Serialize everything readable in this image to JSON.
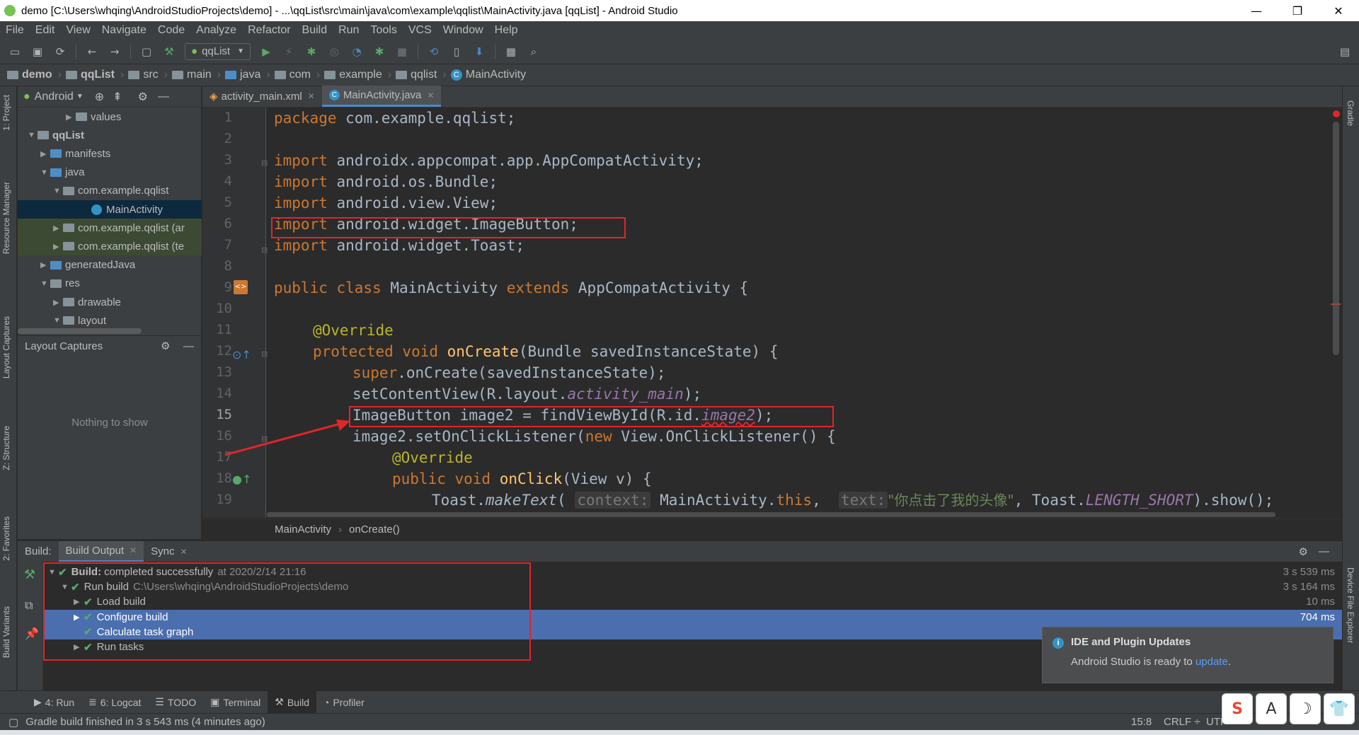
{
  "window": {
    "title": "demo [C:\\Users\\whqing\\AndroidStudioProjects\\demo] - ...\\qqList\\src\\main\\java\\com\\example\\qqlist\\MainActivity.java [qqList] - Android Studio",
    "minimize": "—",
    "maximize": "❐",
    "close": "✕"
  },
  "menu": [
    "File",
    "Edit",
    "View",
    "Navigate",
    "Code",
    "Analyze",
    "Refactor",
    "Build",
    "Run",
    "Tools",
    "VCS",
    "Window",
    "Help"
  ],
  "toolbar": {
    "run_config": "qqList"
  },
  "breadcrumb": [
    "demo",
    "qqList",
    "src",
    "main",
    "java",
    "com",
    "example",
    "qqlist",
    "MainActivity"
  ],
  "left_stripe": [
    "1: Project",
    "Resource Manager",
    "Layout Captures",
    "Z: Structure",
    "2: Favorites",
    "Build Variants"
  ],
  "right_stripe": [
    "Gradle",
    "Device File Explorer"
  ],
  "project": {
    "view": "Android",
    "tree": [
      {
        "label": "values",
        "indent": 3,
        "arrow": "▶",
        "icon": "folder"
      },
      {
        "label": "qqList",
        "indent": 0,
        "arrow": "▼",
        "icon": "module",
        "bold": true
      },
      {
        "label": "manifests",
        "indent": 1,
        "arrow": "▶",
        "icon": "folder-blue"
      },
      {
        "label": "java",
        "indent": 1,
        "arrow": "▼",
        "icon": "folder-blue"
      },
      {
        "label": "com.example.qqlist",
        "indent": 2,
        "arrow": "▼",
        "icon": "folder"
      },
      {
        "label": "MainActivity",
        "indent": 4,
        "arrow": "",
        "icon": "class",
        "selected": true
      },
      {
        "label": "com.example.qqlist (ar",
        "indent": 2,
        "arrow": "▶",
        "icon": "folder"
      },
      {
        "label": "com.example.qqlist (te",
        "indent": 2,
        "arrow": "▶",
        "icon": "folder"
      },
      {
        "label": "generatedJava",
        "indent": 1,
        "arrow": "▶",
        "icon": "folder-blue"
      },
      {
        "label": "res",
        "indent": 1,
        "arrow": "▼",
        "icon": "folder"
      },
      {
        "label": "drawable",
        "indent": 2,
        "arrow": "▶",
        "icon": "folder"
      },
      {
        "label": "layout",
        "indent": 2,
        "arrow": "▼",
        "icon": "folder"
      }
    ]
  },
  "layout_captures": {
    "title": "Layout Captures",
    "empty": "Nothing to show"
  },
  "editor": {
    "tabs": [
      {
        "label": "activity_main.xml",
        "active": false
      },
      {
        "label": "MainActivity.java",
        "active": true
      }
    ],
    "line_numbers": [
      "1",
      "2",
      "3",
      "4",
      "5",
      "6",
      "7",
      "8",
      "9",
      "10",
      "11",
      "12",
      "13",
      "14",
      "15",
      "16",
      "17",
      "18",
      "19"
    ],
    "current_line": "15",
    "code": {
      "l1_kw": "package ",
      "l1_rest": "com.example.qqlist;",
      "l3_kw": "import ",
      "l3_rest": "androidx.appcompat.app.AppCompatActivity;",
      "l4_kw": "import ",
      "l4_rest": "android.os.Bundle;",
      "l5_kw": "import ",
      "l5_rest": "android.view.View;",
      "l6_kw": "import ",
      "l6_rest": "android.widget.ImageButton;",
      "l7_kw": "import ",
      "l7_rest": "android.widget.Toast;",
      "l9_kw1": "public class ",
      "l9_name": "MainActivity ",
      "l9_kw2": "extends ",
      "l9_rest": "AppCompatActivity {",
      "l11_ann": "@Override",
      "l12_kw": "protected void ",
      "l12_fn": "onCreate",
      "l12_rest": "(Bundle savedInstanceState) {",
      "l13_kw": "super",
      "l13_rest": ".onCreate(savedInstanceState);",
      "l14_a": "setContentView(R.layout.",
      "l14_it": "activity_main",
      "l14_b": ");",
      "l15_a": "ImageButton image2 = findViewById(R.id.",
      "l15_it": "image2",
      "l15_b": ");",
      "l16_a": "image2.setOnClickListener(",
      "l16_kw": "new ",
      "l16_b": "View.OnClickListener() {",
      "l17_ann": "@Override",
      "l18_kw": "public void ",
      "l18_fn": "onClick",
      "l18_rest": "(View v) {",
      "l19_a": "Toast.",
      "l19_st": "makeText",
      "l19_b": "( ",
      "l19_hint1": "context:",
      "l19_c": " MainActivity.",
      "l19_kw": "this",
      "l19_d": ",  ",
      "l19_hint2": "text:",
      "l19_str": "\"你点击了我的头像\"",
      "l19_e": ", Toast.",
      "l19_it": "LENGTH_SHORT",
      "l19_f": ").show();"
    },
    "breadcrumb": [
      "MainActivity",
      "onCreate()"
    ]
  },
  "build": {
    "header": [
      "Build:",
      "Build Output",
      "Sync"
    ],
    "rows": [
      {
        "label": "Build:",
        "rest": "completed successfully",
        "dim": "at 2020/2/14 21:16",
        "time": "3 s 539 ms",
        "indent": 0,
        "arrow": "▼"
      },
      {
        "label": "Run build",
        "dim": "C:\\Users\\whqing\\AndroidStudioProjects\\demo",
        "time": "3 s 164 ms",
        "indent": 1,
        "arrow": "▼"
      },
      {
        "label": "Load build",
        "time": "10 ms",
        "indent": 2,
        "arrow": "▶"
      },
      {
        "label": "Configure build",
        "time": "704 ms",
        "indent": 2,
        "arrow": "▶",
        "selected": true
      },
      {
        "label": "Calculate task graph",
        "time": "",
        "indent": 2,
        "arrow": "",
        "selected": true
      },
      {
        "label": "Run tasks",
        "time": "",
        "indent": 2,
        "arrow": "▶"
      }
    ]
  },
  "notification": {
    "title": "IDE and Plugin Updates",
    "body": "Android Studio is ready to ",
    "link": "update",
    "tail": "."
  },
  "bottom_tools": [
    {
      "label": "4: Run",
      "icon": "▶"
    },
    {
      "label": "6: Logcat",
      "icon": "≣"
    },
    {
      "label": "TODO",
      "icon": "☰"
    },
    {
      "label": "Terminal",
      "icon": "▣"
    },
    {
      "label": "Build",
      "icon": "⚒",
      "active": true
    },
    {
      "label": "Profiler",
      "icon": "◔"
    }
  ],
  "status": {
    "message": "Gradle build finished in 3 s 543 ms (4 minutes ago)",
    "position": "15:8",
    "line_sep": "CRLF ÷",
    "encoding": "UTF"
  },
  "ime": [
    "S",
    "A",
    "☽",
    "👕"
  ]
}
